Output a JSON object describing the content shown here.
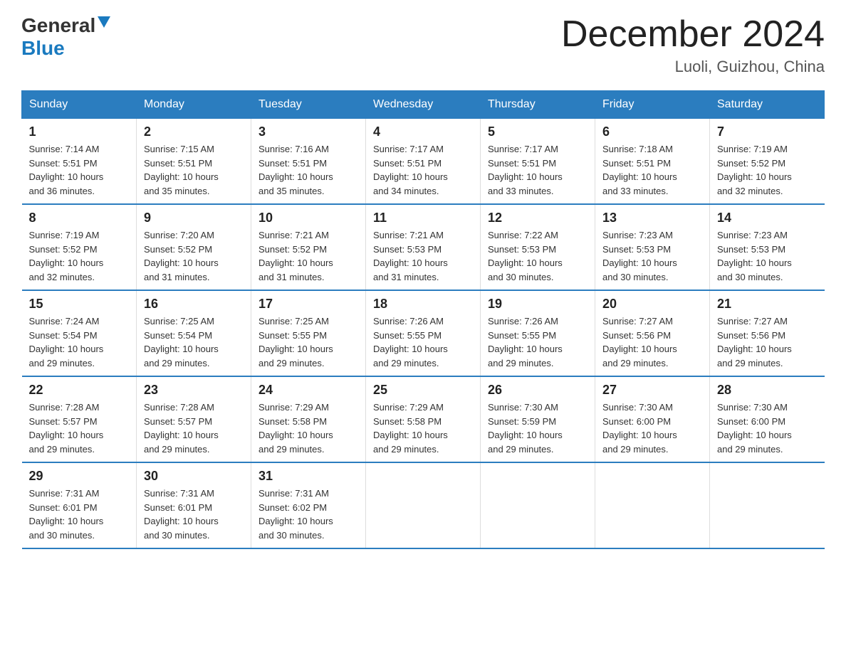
{
  "header": {
    "logo_general": "General",
    "logo_blue": "Blue",
    "month_title": "December 2024",
    "location": "Luoli, Guizhou, China"
  },
  "days_of_week": [
    "Sunday",
    "Monday",
    "Tuesday",
    "Wednesday",
    "Thursday",
    "Friday",
    "Saturday"
  ],
  "weeks": [
    [
      {
        "day": "1",
        "sunrise": "7:14 AM",
        "sunset": "5:51 PM",
        "daylight": "10 hours and 36 minutes."
      },
      {
        "day": "2",
        "sunrise": "7:15 AM",
        "sunset": "5:51 PM",
        "daylight": "10 hours and 35 minutes."
      },
      {
        "day": "3",
        "sunrise": "7:16 AM",
        "sunset": "5:51 PM",
        "daylight": "10 hours and 35 minutes."
      },
      {
        "day": "4",
        "sunrise": "7:17 AM",
        "sunset": "5:51 PM",
        "daylight": "10 hours and 34 minutes."
      },
      {
        "day": "5",
        "sunrise": "7:17 AM",
        "sunset": "5:51 PM",
        "daylight": "10 hours and 33 minutes."
      },
      {
        "day": "6",
        "sunrise": "7:18 AM",
        "sunset": "5:51 PM",
        "daylight": "10 hours and 33 minutes."
      },
      {
        "day": "7",
        "sunrise": "7:19 AM",
        "sunset": "5:52 PM",
        "daylight": "10 hours and 32 minutes."
      }
    ],
    [
      {
        "day": "8",
        "sunrise": "7:19 AM",
        "sunset": "5:52 PM",
        "daylight": "10 hours and 32 minutes."
      },
      {
        "day": "9",
        "sunrise": "7:20 AM",
        "sunset": "5:52 PM",
        "daylight": "10 hours and 31 minutes."
      },
      {
        "day": "10",
        "sunrise": "7:21 AM",
        "sunset": "5:52 PM",
        "daylight": "10 hours and 31 minutes."
      },
      {
        "day": "11",
        "sunrise": "7:21 AM",
        "sunset": "5:53 PM",
        "daylight": "10 hours and 31 minutes."
      },
      {
        "day": "12",
        "sunrise": "7:22 AM",
        "sunset": "5:53 PM",
        "daylight": "10 hours and 30 minutes."
      },
      {
        "day": "13",
        "sunrise": "7:23 AM",
        "sunset": "5:53 PM",
        "daylight": "10 hours and 30 minutes."
      },
      {
        "day": "14",
        "sunrise": "7:23 AM",
        "sunset": "5:53 PM",
        "daylight": "10 hours and 30 minutes."
      }
    ],
    [
      {
        "day": "15",
        "sunrise": "7:24 AM",
        "sunset": "5:54 PM",
        "daylight": "10 hours and 29 minutes."
      },
      {
        "day": "16",
        "sunrise": "7:25 AM",
        "sunset": "5:54 PM",
        "daylight": "10 hours and 29 minutes."
      },
      {
        "day": "17",
        "sunrise": "7:25 AM",
        "sunset": "5:55 PM",
        "daylight": "10 hours and 29 minutes."
      },
      {
        "day": "18",
        "sunrise": "7:26 AM",
        "sunset": "5:55 PM",
        "daylight": "10 hours and 29 minutes."
      },
      {
        "day": "19",
        "sunrise": "7:26 AM",
        "sunset": "5:55 PM",
        "daylight": "10 hours and 29 minutes."
      },
      {
        "day": "20",
        "sunrise": "7:27 AM",
        "sunset": "5:56 PM",
        "daylight": "10 hours and 29 minutes."
      },
      {
        "day": "21",
        "sunrise": "7:27 AM",
        "sunset": "5:56 PM",
        "daylight": "10 hours and 29 minutes."
      }
    ],
    [
      {
        "day": "22",
        "sunrise": "7:28 AM",
        "sunset": "5:57 PM",
        "daylight": "10 hours and 29 minutes."
      },
      {
        "day": "23",
        "sunrise": "7:28 AM",
        "sunset": "5:57 PM",
        "daylight": "10 hours and 29 minutes."
      },
      {
        "day": "24",
        "sunrise": "7:29 AM",
        "sunset": "5:58 PM",
        "daylight": "10 hours and 29 minutes."
      },
      {
        "day": "25",
        "sunrise": "7:29 AM",
        "sunset": "5:58 PM",
        "daylight": "10 hours and 29 minutes."
      },
      {
        "day": "26",
        "sunrise": "7:30 AM",
        "sunset": "5:59 PM",
        "daylight": "10 hours and 29 minutes."
      },
      {
        "day": "27",
        "sunrise": "7:30 AM",
        "sunset": "6:00 PM",
        "daylight": "10 hours and 29 minutes."
      },
      {
        "day": "28",
        "sunrise": "7:30 AM",
        "sunset": "6:00 PM",
        "daylight": "10 hours and 29 minutes."
      }
    ],
    [
      {
        "day": "29",
        "sunrise": "7:31 AM",
        "sunset": "6:01 PM",
        "daylight": "10 hours and 30 minutes."
      },
      {
        "day": "30",
        "sunrise": "7:31 AM",
        "sunset": "6:01 PM",
        "daylight": "10 hours and 30 minutes."
      },
      {
        "day": "31",
        "sunrise": "7:31 AM",
        "sunset": "6:02 PM",
        "daylight": "10 hours and 30 minutes."
      },
      null,
      null,
      null,
      null
    ]
  ],
  "labels": {
    "sunrise": "Sunrise:",
    "sunset": "Sunset:",
    "daylight": "Daylight:"
  }
}
